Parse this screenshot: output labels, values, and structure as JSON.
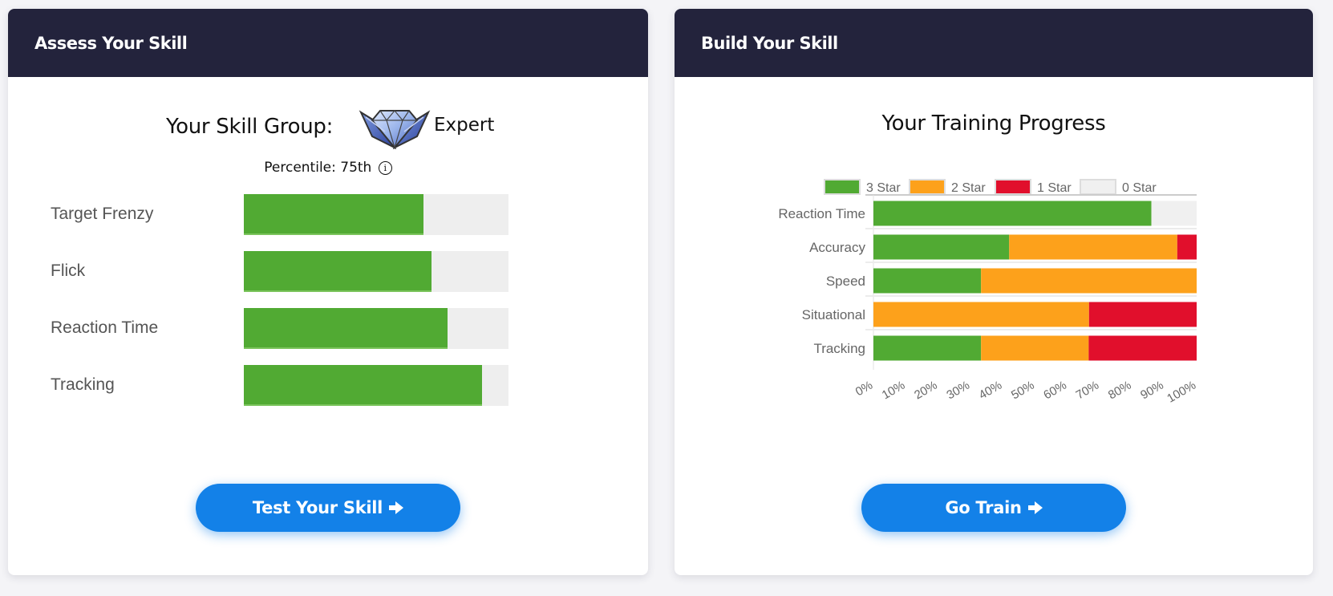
{
  "assess": {
    "header": "Assess Your Skill",
    "skill_group_label": "Your Skill Group:",
    "skill_group_badge": "diamond-wings-badge-icon",
    "skill_group_name": "Expert",
    "percentile_text": "Percentile: 75th",
    "info_icon": "i",
    "bar_color": "#51aa33",
    "track_color": "#eeeeee",
    "skills": [
      {
        "label": "Target Frenzy",
        "percent": 68
      },
      {
        "label": "Flick",
        "percent": 71
      },
      {
        "label": "Reaction Time",
        "percent": 77
      },
      {
        "label": "Tracking",
        "percent": 90
      }
    ],
    "button_label": "Test Your Skill",
    "button_icon": "arrow-right-icon"
  },
  "build": {
    "header": "Build Your Skill",
    "chart_title": "Your Training Progress",
    "button_label": "Go Train",
    "button_icon": "arrow-right-icon"
  },
  "colors": {
    "header_bg": "#23233c",
    "accent_blue": "#1381e8",
    "star3": "#51aa33",
    "star2": "#fda11b",
    "star1": "#e10f2c",
    "star0": "#f0f0f0"
  },
  "chart_data": {
    "type": "bar",
    "orientation": "horizontal",
    "stacked": true,
    "title": "Your Training Progress",
    "categories": [
      "Reaction Time",
      "Accuracy",
      "Speed",
      "Situational",
      "Tracking"
    ],
    "series": [
      {
        "name": "3 Star",
        "color": "#51aa33",
        "values": [
          86,
          42,
          33.3,
          0,
          33.3
        ]
      },
      {
        "name": "2 Star",
        "color": "#fda11b",
        "values": [
          0,
          52,
          66.7,
          66.7,
          33.3
        ]
      },
      {
        "name": "1 Star",
        "color": "#e10f2c",
        "values": [
          0,
          6,
          0,
          33.3,
          33.4
        ]
      },
      {
        "name": "0 Star",
        "color": "#f0f0f0",
        "values": [
          14,
          0,
          0,
          0,
          0
        ]
      }
    ],
    "xlim": [
      0,
      100
    ],
    "xticks": [
      "0%",
      "10%",
      "20%",
      "30%",
      "40%",
      "50%",
      "60%",
      "70%",
      "80%",
      "90%",
      "100%"
    ],
    "xlabel": "",
    "ylabel": "",
    "legend": "top",
    "grid": true
  }
}
